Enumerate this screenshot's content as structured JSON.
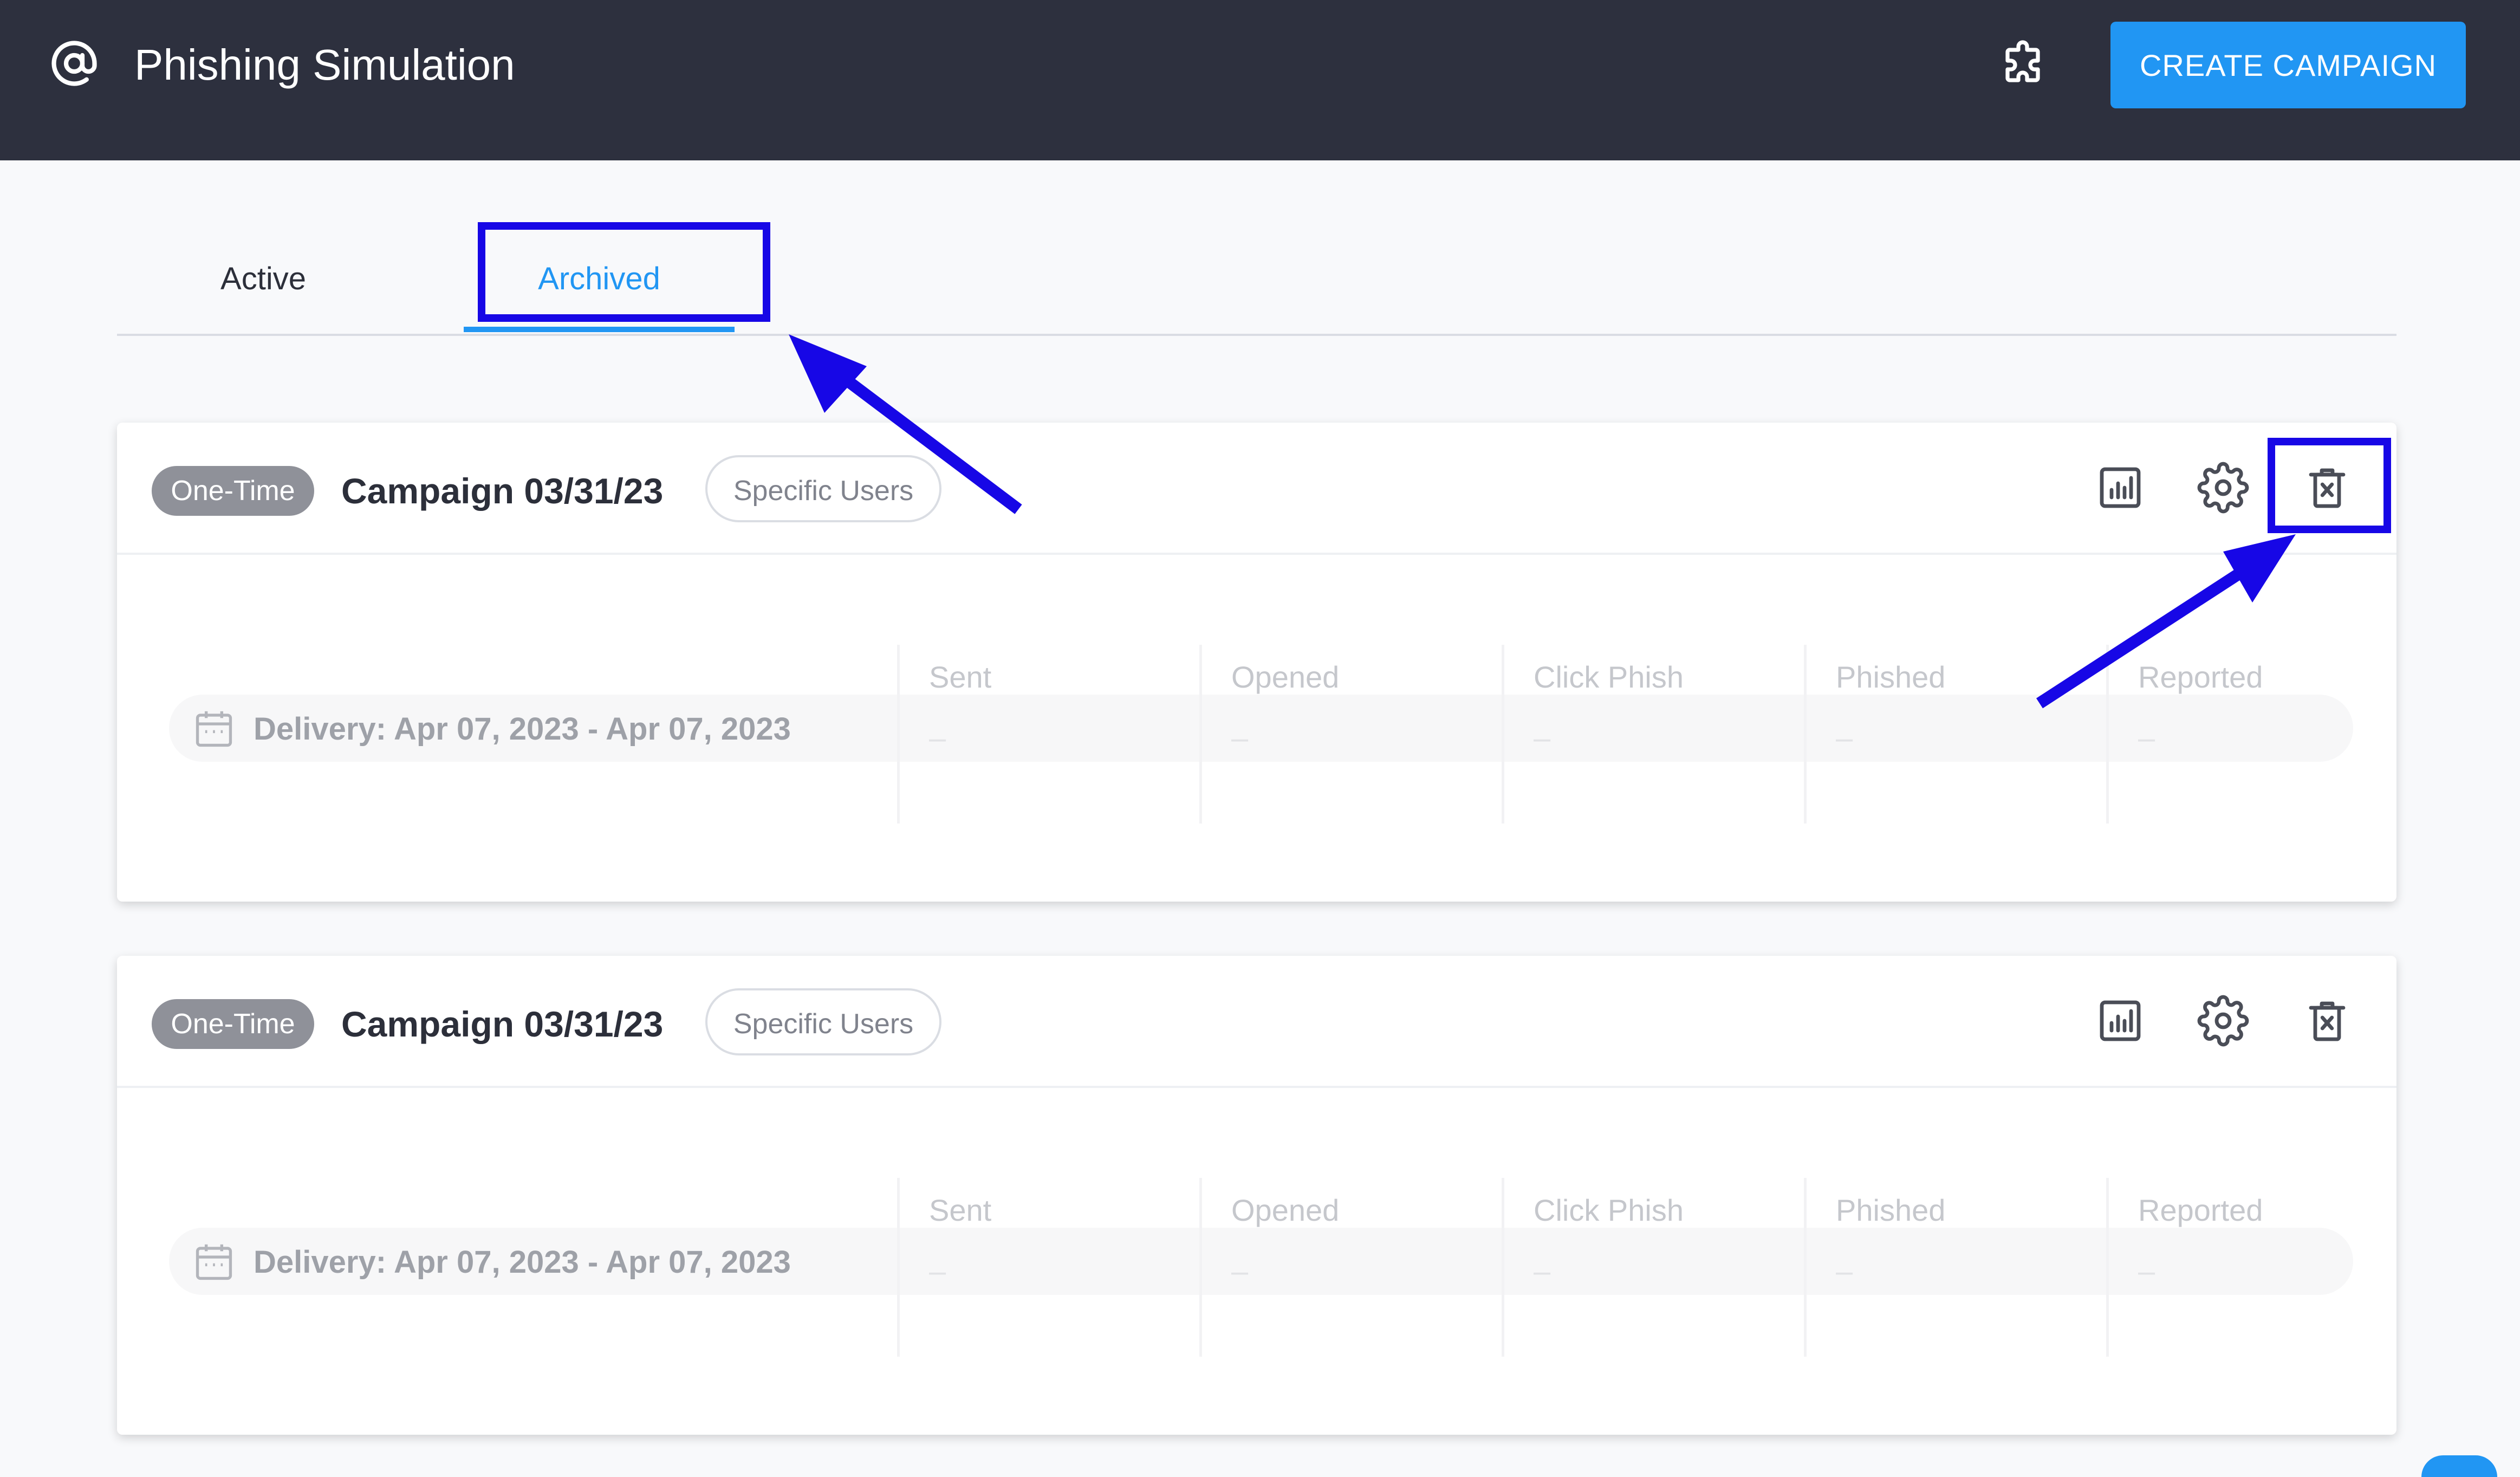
{
  "header": {
    "title": "Phishing Simulation",
    "create_button_label": "CREATE CAMPAIGN"
  },
  "tabs": [
    {
      "label": "Active",
      "selected": false
    },
    {
      "label": "Archived",
      "selected": true
    }
  ],
  "stat_labels": [
    "Sent",
    "Opened",
    "Click Phish",
    "Phished",
    "Reported"
  ],
  "campaigns": [
    {
      "type": "One-Time",
      "name": "Campaign 03/31/23",
      "audience": "Specific Users",
      "delivery": "Delivery: Apr 07, 2023 - Apr 07, 2023",
      "stats": [
        "–",
        "–",
        "–",
        "–",
        "–"
      ]
    },
    {
      "type": "One-Time",
      "name": "Campaign 03/31/23",
      "audience": "Specific Users",
      "delivery": "Delivery: Apr 07, 2023 - Apr 07, 2023",
      "stats": [
        "–",
        "–",
        "–",
        "–",
        "–"
      ]
    }
  ],
  "icons": {
    "app": "at-sign-icon",
    "integrations": "puzzle-icon",
    "report": "bar-chart-icon",
    "settings": "gear-icon",
    "delete": "trash-x-icon",
    "calendar": "calendar-icon"
  },
  "colors": {
    "topbar": "#2d303e",
    "accent": "#2196f3",
    "badge": "#8f9199",
    "annotation": "#1707e6"
  }
}
